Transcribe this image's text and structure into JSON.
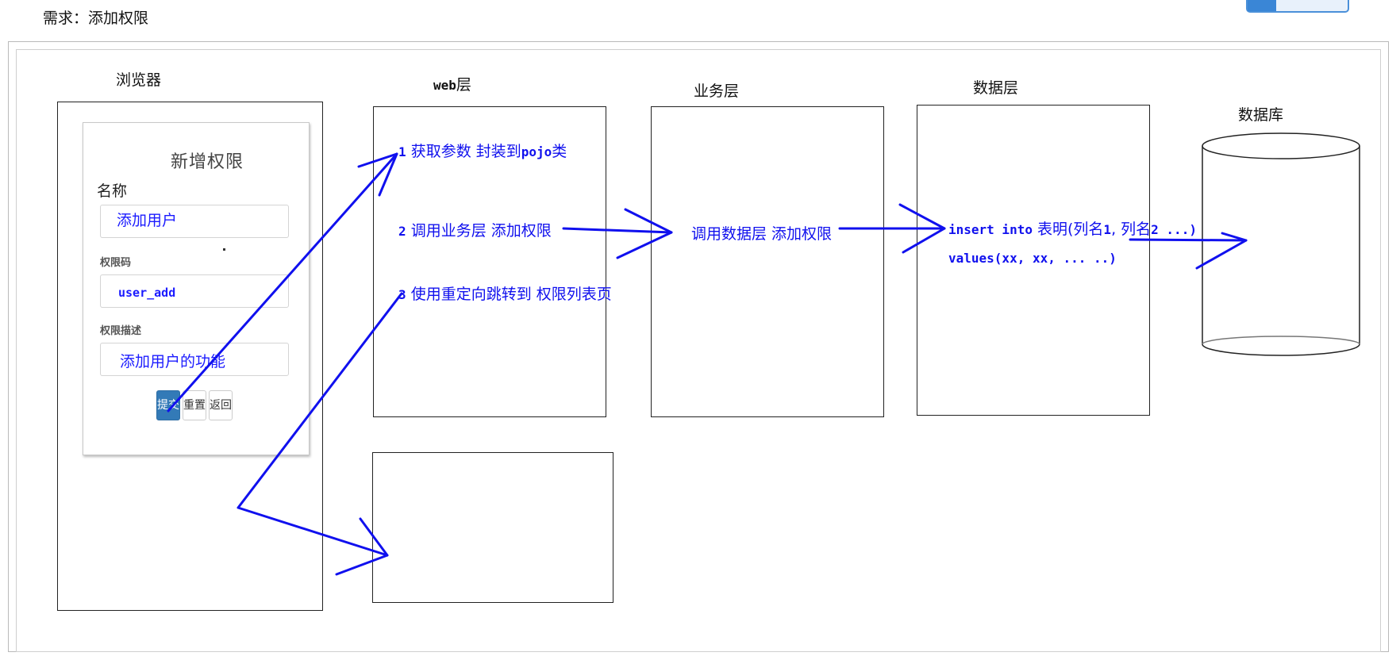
{
  "title": "需求：添加权限",
  "browser": {
    "label": "浏览器",
    "form": {
      "title": "新增权限",
      "name_label": "名称",
      "name_value": "添加用户",
      "code_label": "权限码",
      "code_value": "user_add",
      "desc_label": "权限描述",
      "desc_value": "添加用户的功能",
      "buttons": [
        "提交",
        "重置",
        "返回"
      ]
    }
  },
  "web_layer": {
    "label_prefix": "web",
    "label_suffix": "层",
    "step1_num": "1",
    "step1_text": "获取参数 封装到",
    "step1_mono": "pojo",
    "step1_tail": "类",
    "step2_num": "2",
    "step2_text": "调用业务层 添加权限",
    "step3_num": "3",
    "step3_text": "使用重定向跳转到 权限列表页"
  },
  "service_layer": {
    "label": "业务层",
    "text": "调用数据层 添加权限"
  },
  "data_layer": {
    "label": "数据层",
    "sql_kw": "insert into",
    "sql_rest1": " 表明(列名",
    "sql_n1": "1",
    "sql_rest2": ", 列名",
    "sql_n2": "2 ...)",
    "sql_line2": "values(xx, xx, ... ..)"
  },
  "database": {
    "label": "数据库"
  },
  "colors": {
    "arrow": "#1010ee",
    "text_blue": "#1010ee",
    "primary_button": "#337ab7"
  }
}
